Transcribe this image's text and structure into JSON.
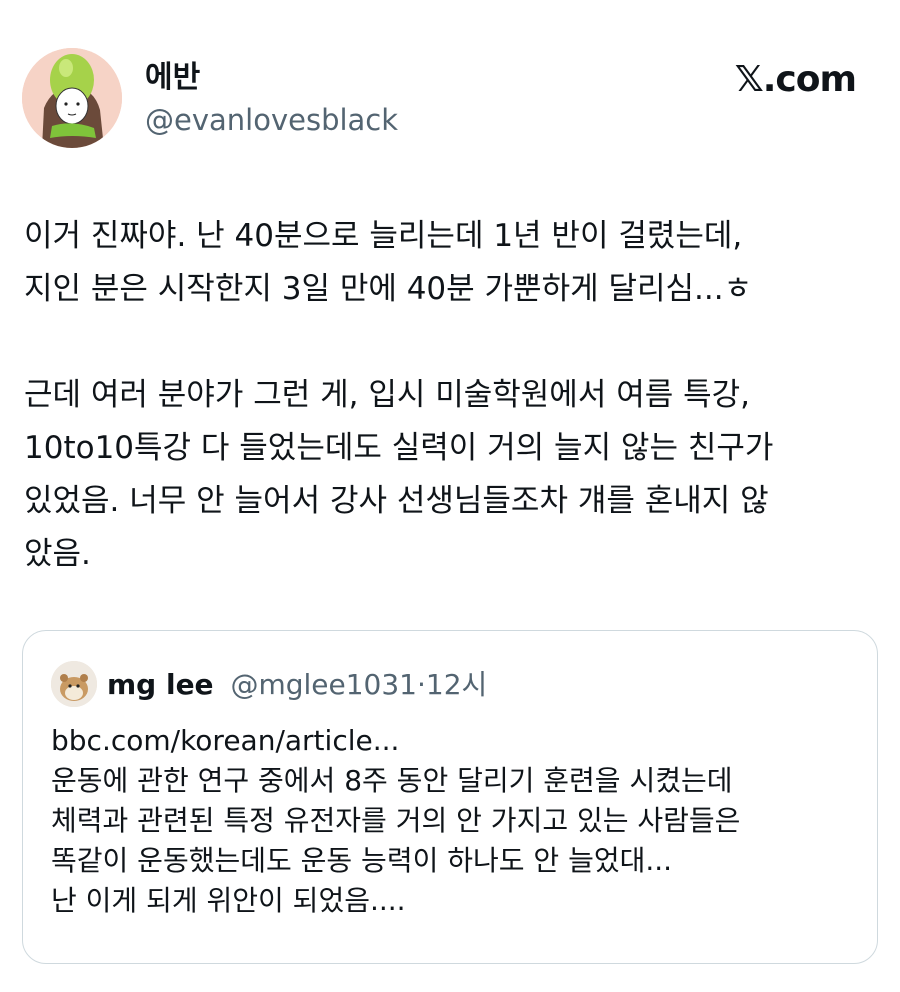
{
  "author": {
    "display_name": "에반",
    "handle": "@evanlovesblack"
  },
  "brand": {
    "label": "𝕏.com"
  },
  "tweet": {
    "lines": [
      "이거 진짜야. 난 40분으로 늘리는데 1년 반이 걸렸는데,",
      "지인 분은 시작한지 3일 만에 40분 가뿐하게 달리심...ㅎ",
      "",
      "근데 여러 분야가 그런 게, 입시 미술학원에서 여름 특강,",
      "10to10특강 다 들었는데도 실력이 거의 늘지 않는 친구가",
      "있었음. 너무 안 늘어서 강사 선생님들조차 걔를 혼내지 않",
      "았음."
    ]
  },
  "quote": {
    "display_name": "mg lee",
    "handle": "@mglee1031",
    "separator": "·",
    "time": "12시",
    "lines": [
      "bbc.com/korean/article...",
      "운동에 관한 연구 중에서 8주 동안 달리기 훈련을 시켰는데",
      "체력과 관련된 특정 유전자를 거의 안 가지고 있는 사람들은",
      "똑같이 운동했는데도 운동 능력이 하나도 안 늘었대...",
      "난 이게 되게 위안이 되었음...."
    ]
  }
}
